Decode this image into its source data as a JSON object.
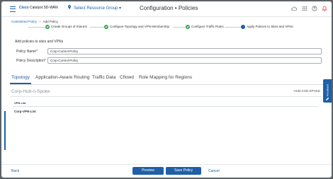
{
  "topbar": {
    "brand_name": "Cisco",
    "brand_product": "Catalyst SD-WAN",
    "resource_group": "Select Resource Group",
    "title": "Configuration • Policies",
    "icons": [
      "cloud-icon",
      "grid-icon",
      "help-icon",
      "notifications-icon"
    ]
  },
  "breadcrumb": {
    "parent": "Centralized Policy",
    "current": "Add Policy"
  },
  "stepper": {
    "steps": [
      {
        "label": "Create Groups of Interest",
        "state": "complete"
      },
      {
        "label": "Configure Topology and VPN Membership",
        "state": "complete"
      },
      {
        "label": "Configure Traffic Rules",
        "state": "complete"
      },
      {
        "label": "Apply Policies to Sites and VPNs",
        "state": "active"
      }
    ]
  },
  "form": {
    "section_title": "Add policies to sites and VPNs",
    "policy_name_label": "Policy Name*",
    "policy_name_value": "Corp-Control-Policy",
    "policy_description_label": "Policy Description*",
    "policy_description_value": "Corp-Control-Policy"
  },
  "tabs": {
    "items": [
      "Topology",
      "Application-Aware Routing",
      "Traffic Data",
      "Cflowd",
      "Role Mapping for Regions"
    ],
    "active": "Topology"
  },
  "topology": {
    "name": "Corp-Hub-n-Spoke",
    "type": "HUB-AND-SPOKE",
    "vpn_list_header": "VPN List",
    "vpn_lists": [
      "Corp-VPN-List"
    ]
  },
  "feedback": {
    "label": "Feedback"
  },
  "footer": {
    "back_label": "Back",
    "preview_label": "Preview",
    "save_label": "Save Policy",
    "cancel_label": "Cancel"
  },
  "colors": {
    "accent": "#1f5fa6",
    "complete": "#2fa34b",
    "notification": "#d9302d"
  }
}
